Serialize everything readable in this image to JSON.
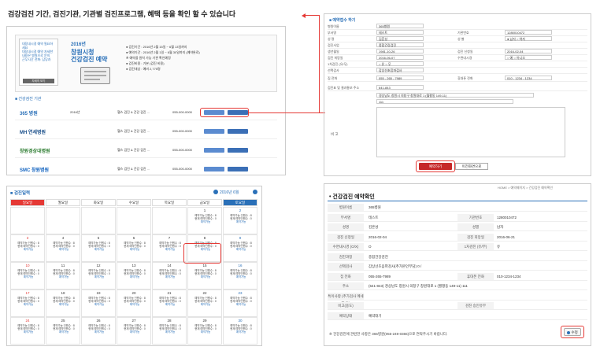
{
  "caption": "검강검진 기간, 검진기관, 기관별 검진프로그램, 혜택 등을 확인 할 수 있습니다",
  "panel1": {
    "side_text": "대장내시경 예약 필요하세요\n대장내시경 예약 자세한 내용은 병원으로 문의\n근무시간 전화: 담당과",
    "side_button": "자세히 보기",
    "year": "2016년",
    "title_line1": "창원시청",
    "title_line2": "건강검진 예약",
    "info": [
      "● 검진기간 : 2016년 2월 15일 ~ 6월 13일까지",
      "● 예약기간 : 2016년 2월 1일 ~ 6월 30일까지 (예약완료)",
      "  ※ 예약을 원칙 가능 기관 확인예정",
      "● 검진비용 : 기본 (검진 비용)",
      "● 검진대상 : 예비 2,775명"
    ],
    "list_title": "■ 건강검진 기관",
    "hospitals": [
      {
        "name": "365 병원",
        "note": "2016년",
        "desc": "헬스 검진 & 건강 검진 ...",
        "tel": "055-000-0000",
        "btn1": "검진프로그램",
        "btn2": "예약하기"
      },
      {
        "name": "MH 연세병원",
        "note": "",
        "desc": "헬스 검진 & 건강 검진 ...",
        "tel": "055-000-0000",
        "btn1": "검진프로그램",
        "btn2": "예약하기"
      },
      {
        "name": "창원경상대병원",
        "note": "",
        "desc": "헬스 검진 & 건강 검진 ...",
        "tel": "055-000-0000",
        "btn1": "검진프로그램",
        "btn2": "예약하기"
      },
      {
        "name": "SMC 창원병원",
        "note": "",
        "desc": "헬스 검진 & 건강 검진 ...",
        "tel": "055-000-0000",
        "btn1": "검진프로그램",
        "btn2": "예약하기"
      }
    ]
  },
  "panel2": {
    "title": "■ 예약접수 하기",
    "rows": [
      {
        "l": "병원이름",
        "v": "365병원",
        "l2": "",
        "v2": ""
      },
      {
        "l": "부서명",
        "v": "테스트",
        "l2": "기관번호",
        "v2": "1280010472"
      },
      {
        "l": "성 명",
        "v": "김흔성",
        "l2": "성 별",
        "v2": "● 남자  ○ 여자"
      },
      {
        "l": "검진사업",
        "v": "종합건강검진",
        "l2": "",
        "v2": ""
      },
      {
        "l": "생년월일",
        "v": "1981-10-26",
        "l2": "검진 신청일",
        "v2": "2016-02-04"
      },
      {
        "l": "검진 희망일",
        "v": "2016-06-07",
        "l2": "수면내시경",
        "v2": "○ 예  ○ 아니오"
      },
      {
        "l": "1차검진 (유/무)",
        "v": "○ 유  ○ 무",
        "l2": "",
        "v2": ""
      },
      {
        "l": "선택검사",
        "v": "갑상선초음파검사",
        "l2": "",
        "v2": ""
      },
      {
        "l": "집 전화",
        "v": "055 - 265 - 7989",
        "l2": "휴대폰 전화",
        "v2": "010 - 1234 - 1234"
      },
      {
        "l": "검진표 및 결과통보 주소",
        "v": "641-843",
        "l2": "",
        "v2": ""
      }
    ],
    "address": "경상남도 창원시 의창구 창원대로 1 (월평동 149-11)",
    "address2": "111",
    "memo_label": "비 고",
    "submit": "예약하기",
    "back": "이전화면으로"
  },
  "calendar": {
    "title": "■ 검진일력",
    "month": "2016년 6월",
    "days": [
      "일요일",
      "월요일",
      "화요일",
      "수요일",
      "목요일",
      "금요일",
      "토요일"
    ],
    "weeks": [
      [
        "",
        "",
        "",
        "",
        "",
        "1",
        "2"
      ],
      [
        "3",
        "4",
        "5",
        "6",
        "7",
        "8",
        "9"
      ],
      [
        "10",
        "11",
        "12",
        "13",
        "14",
        "15",
        "16"
      ],
      [
        "17",
        "18",
        "19",
        "20",
        "21",
        "22",
        "23"
      ],
      [
        "24",
        "25",
        "26",
        "27",
        "28",
        "29",
        "30"
      ]
    ],
    "cell_line1": "예약가능 인원수 : 8",
    "cell_line2": "현재 예약인원수 : 0",
    "cell_status": "예약가능"
  },
  "panel4": {
    "breadcrumb": "HOME > 예약페이지 > 건강검진 예약확인",
    "title": "• 건강검진 예약확인",
    "rows": [
      {
        "l": "병원이름",
        "v": "365병원",
        "l2": "",
        "v2": ""
      },
      {
        "l": "부서명",
        "v": "테스트",
        "l2": "기관번호",
        "v2": "1280010472"
      },
      {
        "l": "성명",
        "v": "김흔성",
        "l2": "성별",
        "v2": "남자"
      },
      {
        "l": "검진 신청일",
        "v": "2016-02-04",
        "l2": "검진 희망일",
        "v2": "2016-06-21"
      },
      {
        "l": "수면내시경 (O/X)",
        "v": "O",
        "l2": "1차검진 (유/무)",
        "v2": "유"
      },
      {
        "l": "검진과정",
        "v": "종합건강검진",
        "l2": "",
        "v2": ""
      },
      {
        "l": "선택검사",
        "v": "갑상선초음파검사(추가본인부담) 0 /",
        "l2": "",
        "v2": ""
      },
      {
        "l": "집 전화",
        "v": "055-265-7989",
        "l2": "휴대폰 전화",
        "v2": "010-1234-1234"
      },
      {
        "l": "주소",
        "v": "(641-843) 경상남도 창원시 의창구 창원대로 1 (월평동 149-11) 111",
        "l2": "",
        "v2": ""
      },
      {
        "l": "특이사항 (추가검사 메세지 등)",
        "v": "",
        "l2": "",
        "v2": ""
      },
      {
        "l": "비고(용도)",
        "v": "",
        "l2": "검진 승인유무",
        "v2": ""
      },
      {
        "l": "예약상태",
        "v": "예약대기",
        "l2": "",
        "v2": ""
      }
    ],
    "footer": "※ 건강검진에 관련한 사항은 365병원(055-249-0365)으로 연락주시기 바랍니다.",
    "edit_button": "수정"
  }
}
